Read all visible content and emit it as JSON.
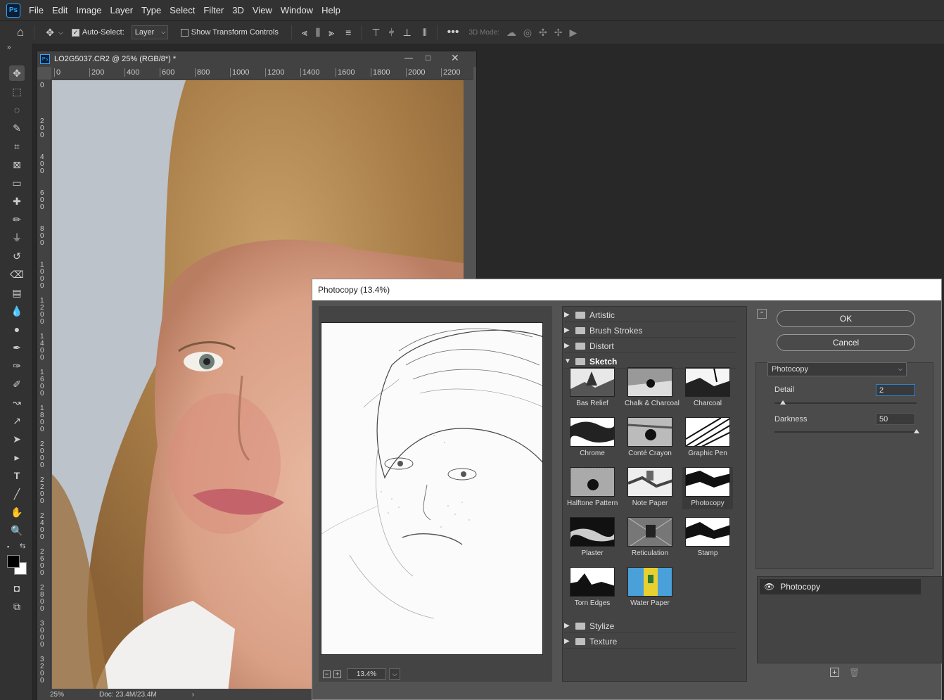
{
  "app": {
    "logo": "Ps"
  },
  "menus": [
    "File",
    "Edit",
    "Image",
    "Layer",
    "Type",
    "Select",
    "Filter",
    "3D",
    "View",
    "Window",
    "Help"
  ],
  "options": {
    "auto_select_label": "Auto-Select:",
    "auto_select_checked": true,
    "auto_select_target": "Layer",
    "show_transform_label": "Show Transform Controls",
    "show_transform_checked": false,
    "mode_3d_label": "3D Mode:"
  },
  "document": {
    "title": "LO2G5037.CR2 @ 25% (RGB/8*) *",
    "ruler_top": [
      "0",
      "200",
      "400",
      "600",
      "800",
      "1000",
      "1200",
      "1400",
      "1600",
      "1800",
      "2000",
      "2200"
    ],
    "ruler_left": [
      "0",
      "200",
      "400",
      "600",
      "800",
      "1000",
      "1200",
      "1400",
      "1600",
      "1800",
      "2000",
      "2200",
      "2400",
      "2600",
      "2800",
      "3000",
      "3200"
    ],
    "zoom": "25%",
    "doc_size": "Doc: 23.4M/23.4M"
  },
  "dialog": {
    "title": "Photocopy (13.4%)",
    "preview_zoom": "13.4%",
    "ok_label": "OK",
    "cancel_label": "Cancel",
    "selected_filter": "Photocopy",
    "categories_top": [
      {
        "label": "Artistic",
        "open": false
      },
      {
        "label": "Brush Strokes",
        "open": false
      },
      {
        "label": "Distort",
        "open": false
      },
      {
        "label": "Sketch",
        "open": true
      }
    ],
    "categories_bottom": [
      {
        "label": "Stylize",
        "open": false
      },
      {
        "label": "Texture",
        "open": false
      }
    ],
    "sketch_filters": [
      "Bas Relief",
      "Chalk & Charcoal",
      "Charcoal",
      "Chrome",
      "Conté Crayon",
      "Graphic Pen",
      "Halftone Pattern",
      "Note Paper",
      "Photocopy",
      "Plaster",
      "Reticulation",
      "Stamp",
      "Torn Edges",
      "Water Paper"
    ],
    "params": {
      "detail_label": "Detail",
      "detail_value": "2",
      "detail_fraction": 0.06,
      "darkness_label": "Darkness",
      "darkness_value": "50",
      "darkness_fraction": 1.0
    },
    "layer_name": "Photocopy"
  }
}
